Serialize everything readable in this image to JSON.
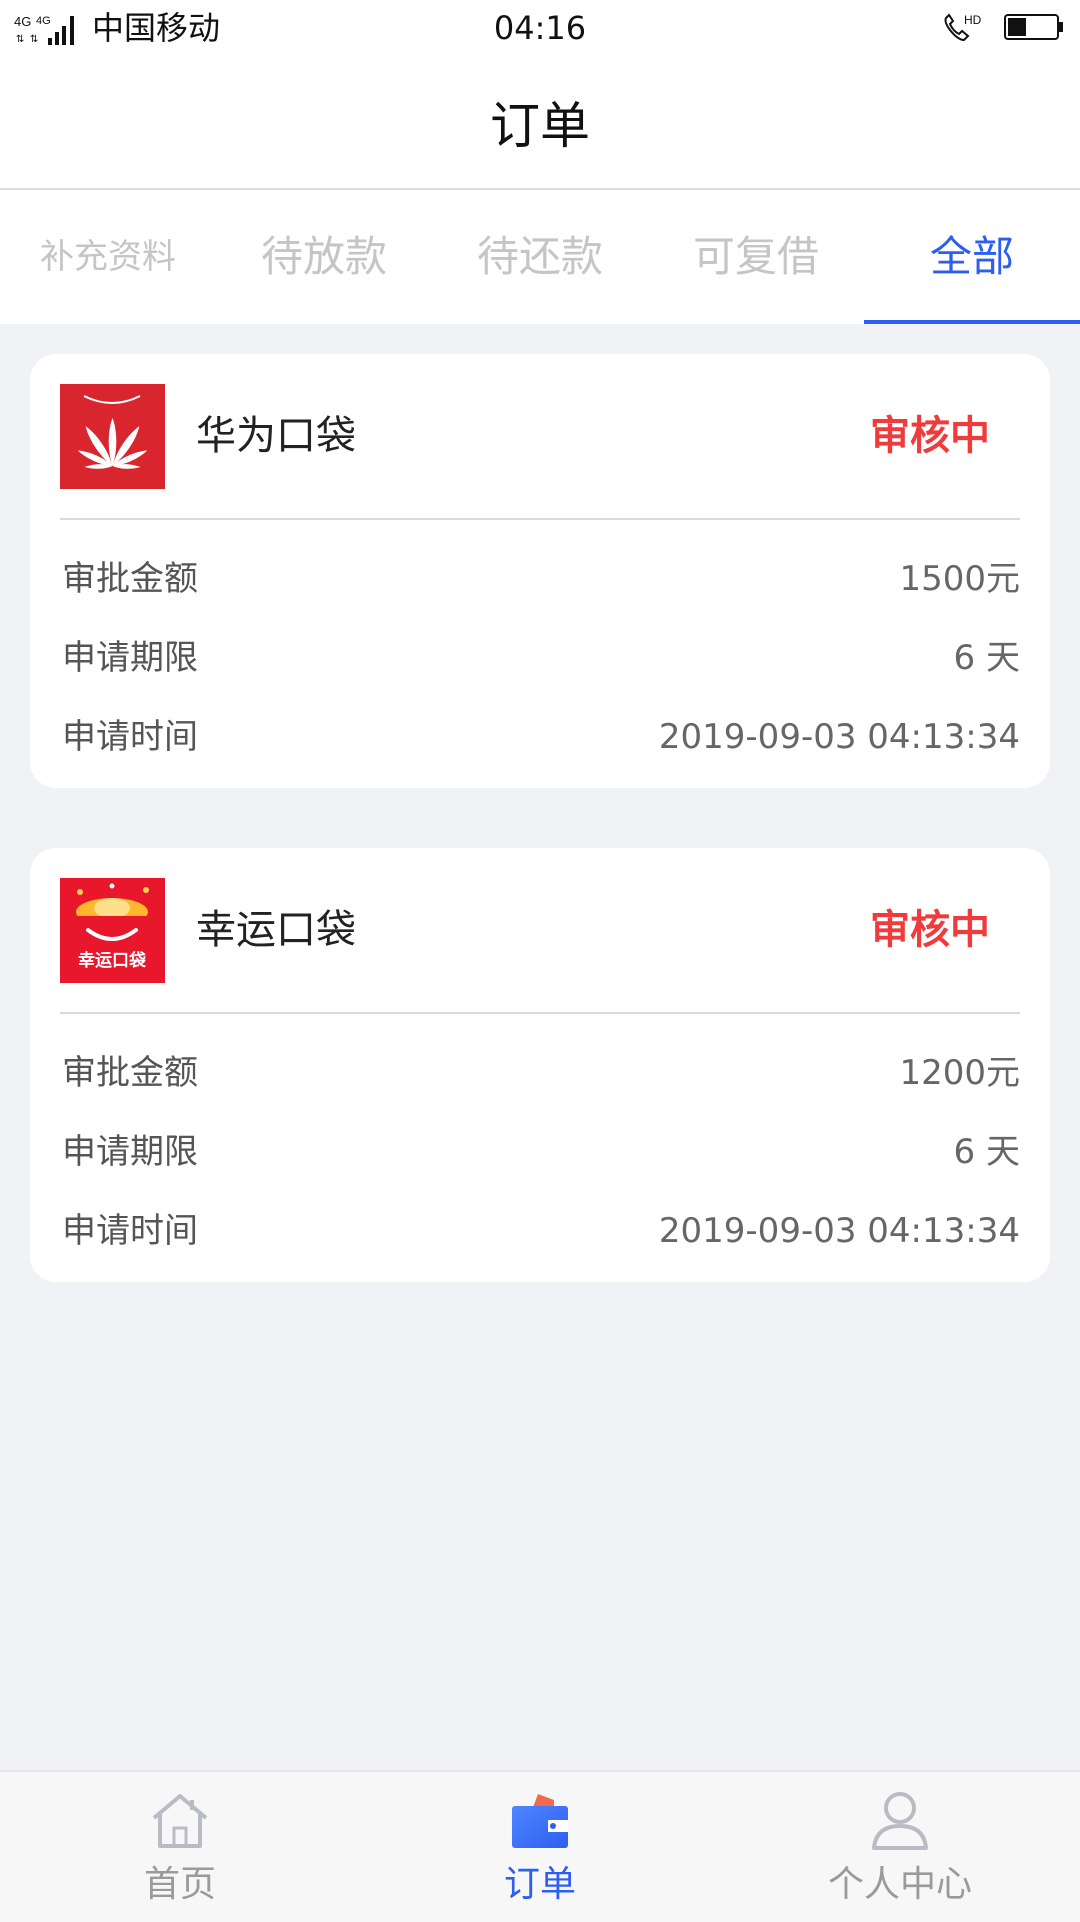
{
  "status_bar": {
    "network": "4G 4G",
    "carrier": "中国移动",
    "time": "04:16",
    "call_badge": "HD"
  },
  "header": {
    "title": "订单"
  },
  "tabs": [
    {
      "label": "补充资料",
      "active": false
    },
    {
      "label": "待放款",
      "active": false
    },
    {
      "label": "待还款",
      "active": false
    },
    {
      "label": "可复借",
      "active": false
    },
    {
      "label": "全部",
      "active": true
    }
  ],
  "orders": [
    {
      "name": "华为口袋",
      "status": "审核中",
      "logo_icon": "huawei-logo-icon",
      "rows": [
        {
          "label": "审批金额",
          "value": "1500元"
        },
        {
          "label": "申请期限",
          "value": "6 天"
        },
        {
          "label": "申请时间",
          "value": "2019-09-03 04:13:34"
        }
      ]
    },
    {
      "name": "幸运口袋",
      "status": "审核中",
      "logo_icon": "lucky-pocket-logo-icon",
      "logo_text": "幸运口袋",
      "rows": [
        {
          "label": "审批金额",
          "value": "1200元"
        },
        {
          "label": "申请期限",
          "value": "6 天"
        },
        {
          "label": "申请时间",
          "value": "2019-09-03 04:13:34"
        }
      ]
    }
  ],
  "tabbar": [
    {
      "label": "首页",
      "icon": "home-icon",
      "active": false
    },
    {
      "label": "订单",
      "icon": "wallet-icon",
      "active": true
    },
    {
      "label": "个人中心",
      "icon": "user-icon",
      "active": false
    }
  ],
  "colors": {
    "accent": "#2d5ef0",
    "status_red": "#ef3b3b",
    "background": "#f0f2f5"
  }
}
